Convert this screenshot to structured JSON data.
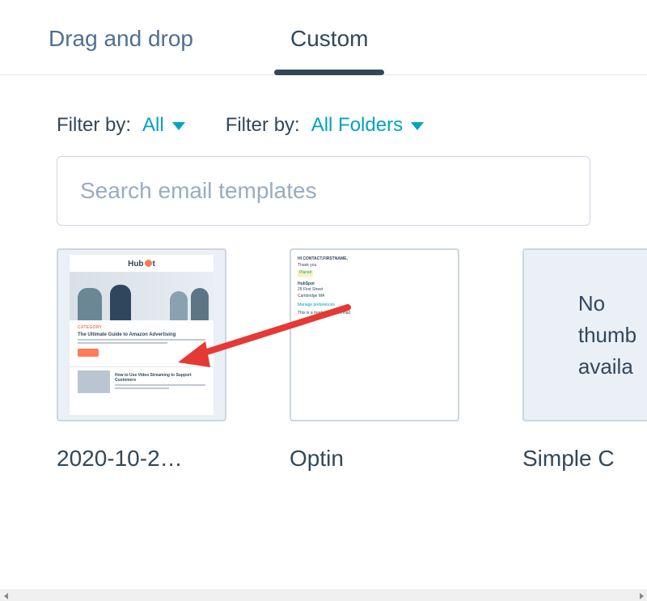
{
  "tabs": {
    "drag": "Drag and drop",
    "custom": "Custom"
  },
  "filters": {
    "label1": "Filter by:",
    "value1": "All",
    "label2": "Filter by:",
    "value2": "All Folders"
  },
  "search": {
    "placeholder": "Search email templates"
  },
  "templates": [
    {
      "title": "2020-10-2…",
      "kind": "hubspot"
    },
    {
      "title": "Optin",
      "kind": "optin"
    },
    {
      "title": "Simple C",
      "kind": "nothumb",
      "thumb_text": "No\nthumb\navaila"
    }
  ],
  "hubspot_preview": {
    "logo_left": "Hub",
    "logo_right": "t",
    "category": "CATEGORY",
    "headline": "The Ultimate Guide to Amazon Advertising",
    "sub_headline": "How to Use Video Streaming to Support Customers"
  },
  "optin_preview": {
    "greeting": "HI CONTACT.FIRSTNAME,",
    "line1": "Thank you",
    "l_name": "HubSpot",
    "l_addr1": "25 First Street",
    "l_addr2": "Cambridge MA",
    "prefs": "Manage preferences",
    "note": "This is a marketing test email."
  }
}
